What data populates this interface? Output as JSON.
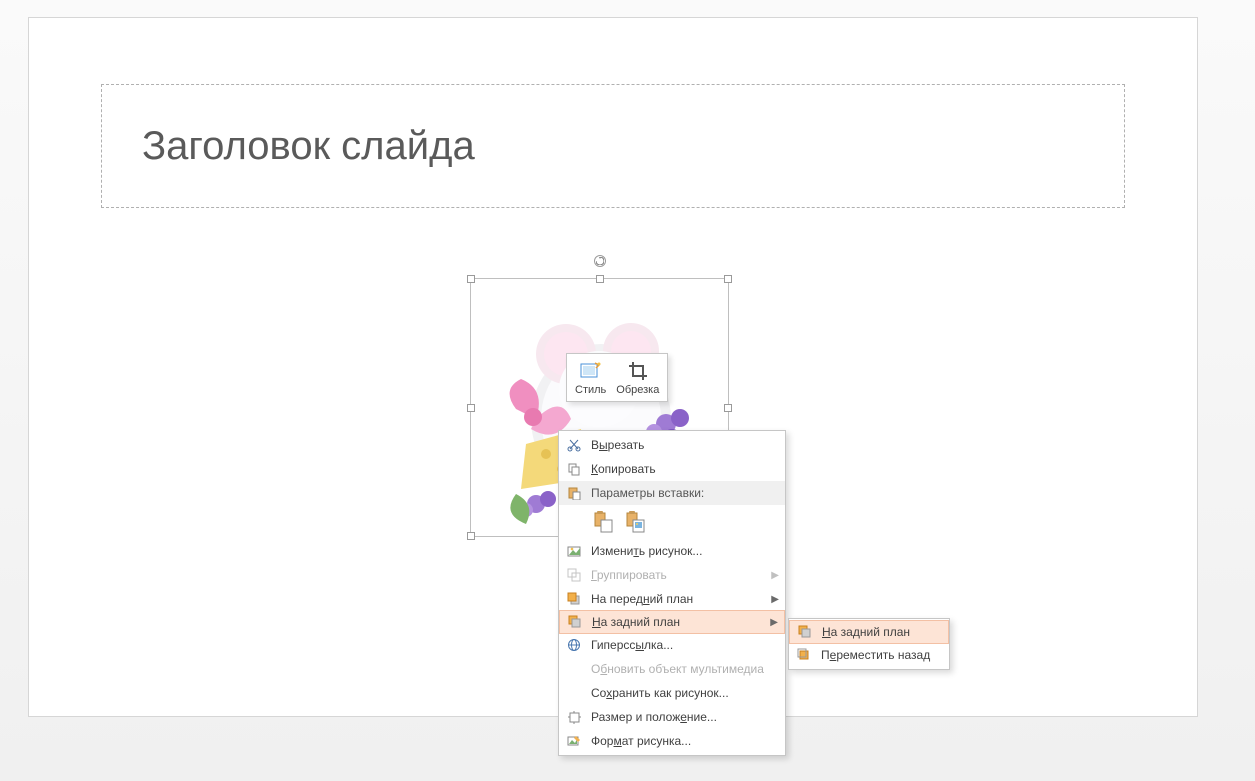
{
  "slide": {
    "title_placeholder": "Заголовок слайда"
  },
  "mini_toolbar": {
    "style_label": "Стиль",
    "crop_label": "Обрезка"
  },
  "context_menu": {
    "cut": "Вырезать",
    "copy": "Копировать",
    "paste_options_header": "Параметры вставки:",
    "change_picture": "Изменить рисунок...",
    "group": "Группировать",
    "bring_to_front": "На передний план",
    "send_to_back": "На задний план",
    "hyperlink": "Гиперссылка...",
    "update_media": "Обновить объект мультимедиа",
    "save_as_picture": "Сохранить как рисунок...",
    "size_and_position": "Размер и положение...",
    "format_picture": "Формат рисунка..."
  },
  "submenu": {
    "send_to_back": "На задний план",
    "send_backward": "Переместить назад"
  },
  "icons": {
    "cut": "scissors-icon",
    "copy": "copy-icon",
    "paste": "paste-icon",
    "paste_picture": "paste-picture-icon",
    "change_picture": "change-picture-icon",
    "group": "group-icon",
    "bring_front": "bring-front-icon",
    "send_back": "send-back-icon",
    "hyperlink": "hyperlink-icon",
    "size_pos": "size-position-icon",
    "format": "format-picture-icon"
  }
}
